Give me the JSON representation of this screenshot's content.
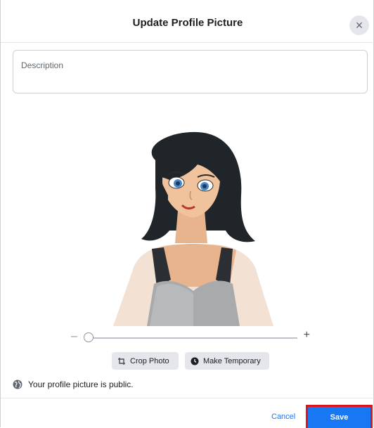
{
  "dialog": {
    "title": "Update Profile Picture",
    "close_symbol": "×"
  },
  "description": {
    "placeholder": "Description",
    "value": ""
  },
  "zoom": {
    "minus_label": "–",
    "plus_label": "+",
    "level": 0.03
  },
  "actions": {
    "crop_label": "Crop Photo",
    "temporary_label": "Make Temporary"
  },
  "privacy": {
    "text": "Your profile picture is public."
  },
  "footer": {
    "cancel_label": "Cancel",
    "save_label": "Save"
  },
  "colors": {
    "primary": "#1877f2",
    "highlight": "#e0151b"
  },
  "icons": {
    "close": "close-icon",
    "crop": "crop-icon",
    "clock": "clock-icon",
    "globe": "globe-icon"
  }
}
